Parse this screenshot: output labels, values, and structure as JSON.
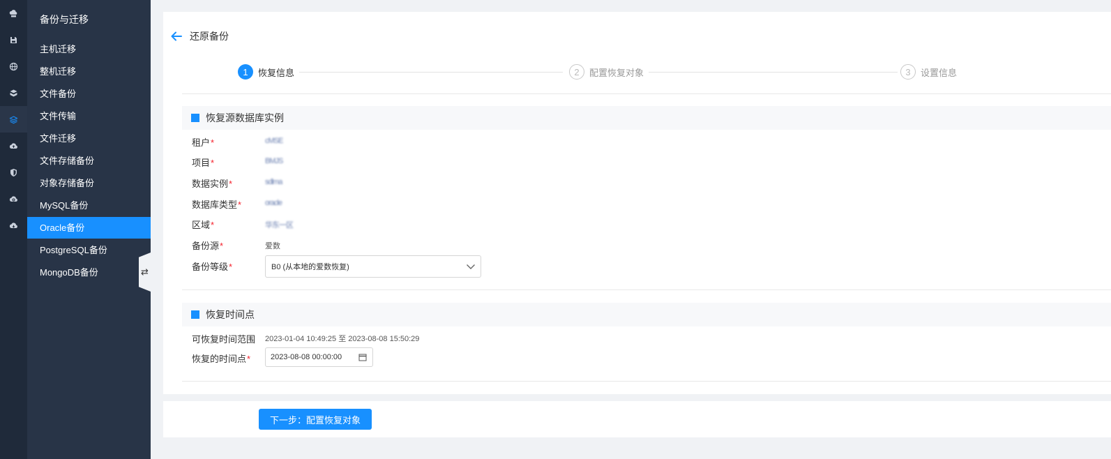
{
  "rail": {
    "icons": [
      "cloud-server-icon",
      "save-disk-icon",
      "globe-icon",
      "cube-stack-icon",
      "database-stack-icon",
      "cloud-upload-icon",
      "shield-icon",
      "cloud-sync-icon",
      "cloud-download-icon"
    ],
    "active_index": 4,
    "icon_color": "#c9d0db",
    "active_icon_color": "#1890ff"
  },
  "menu": {
    "title": "备份与迁移",
    "items": [
      {
        "label": "主机迁移"
      },
      {
        "label": "整机迁移"
      },
      {
        "label": "文件备份"
      },
      {
        "label": "文件传输"
      },
      {
        "label": "文件迁移"
      },
      {
        "label": "文件存储备份"
      },
      {
        "label": "对象存储备份"
      },
      {
        "label": "MySQL备份"
      },
      {
        "label": "Oracle备份",
        "active": true
      },
      {
        "label": "PostgreSQL备份"
      },
      {
        "label": "MongoDB备份"
      }
    ],
    "collapse_glyph": "⇄"
  },
  "page": {
    "title": "还原备份",
    "accent": "#1890ff"
  },
  "steps": [
    {
      "num": "1",
      "label": "恢复信息",
      "state": "current"
    },
    {
      "num": "2",
      "label": "配置恢复对象",
      "state": "pending"
    },
    {
      "num": "3",
      "label": "设置信息",
      "state": "pending"
    }
  ],
  "source_section": {
    "title": "恢复源数据库实例",
    "fields": {
      "tenant": {
        "label": "租户",
        "required": "*",
        "value": "cMSE"
      },
      "project": {
        "label": "项目",
        "required": "*",
        "value": "BMJS"
      },
      "instance": {
        "label": "数据实例",
        "required": "*",
        "value": "sdlma"
      },
      "db_type": {
        "label": "数据库类型",
        "required": "*",
        "value": "oracle"
      },
      "region": {
        "label": "区域",
        "required": "*",
        "value": "华东一区"
      },
      "backup_source": {
        "label": "备份源",
        "required": "*",
        "value": "爱数"
      },
      "backup_level": {
        "label": "备份等级",
        "required": "*",
        "value": "B0 (从本地的爱数恢复)"
      }
    }
  },
  "time_section": {
    "title": "恢复时间点",
    "range_label": "可恢复时间范围",
    "range_value": "2023-01-04 10:49:25 至 2023-08-08 15:50:29",
    "point_label": "恢复的时间点",
    "point_required": "*",
    "point_value": "2023-08-08 00:00:00"
  },
  "footer": {
    "next_label": "下一步：配置恢复对象"
  }
}
